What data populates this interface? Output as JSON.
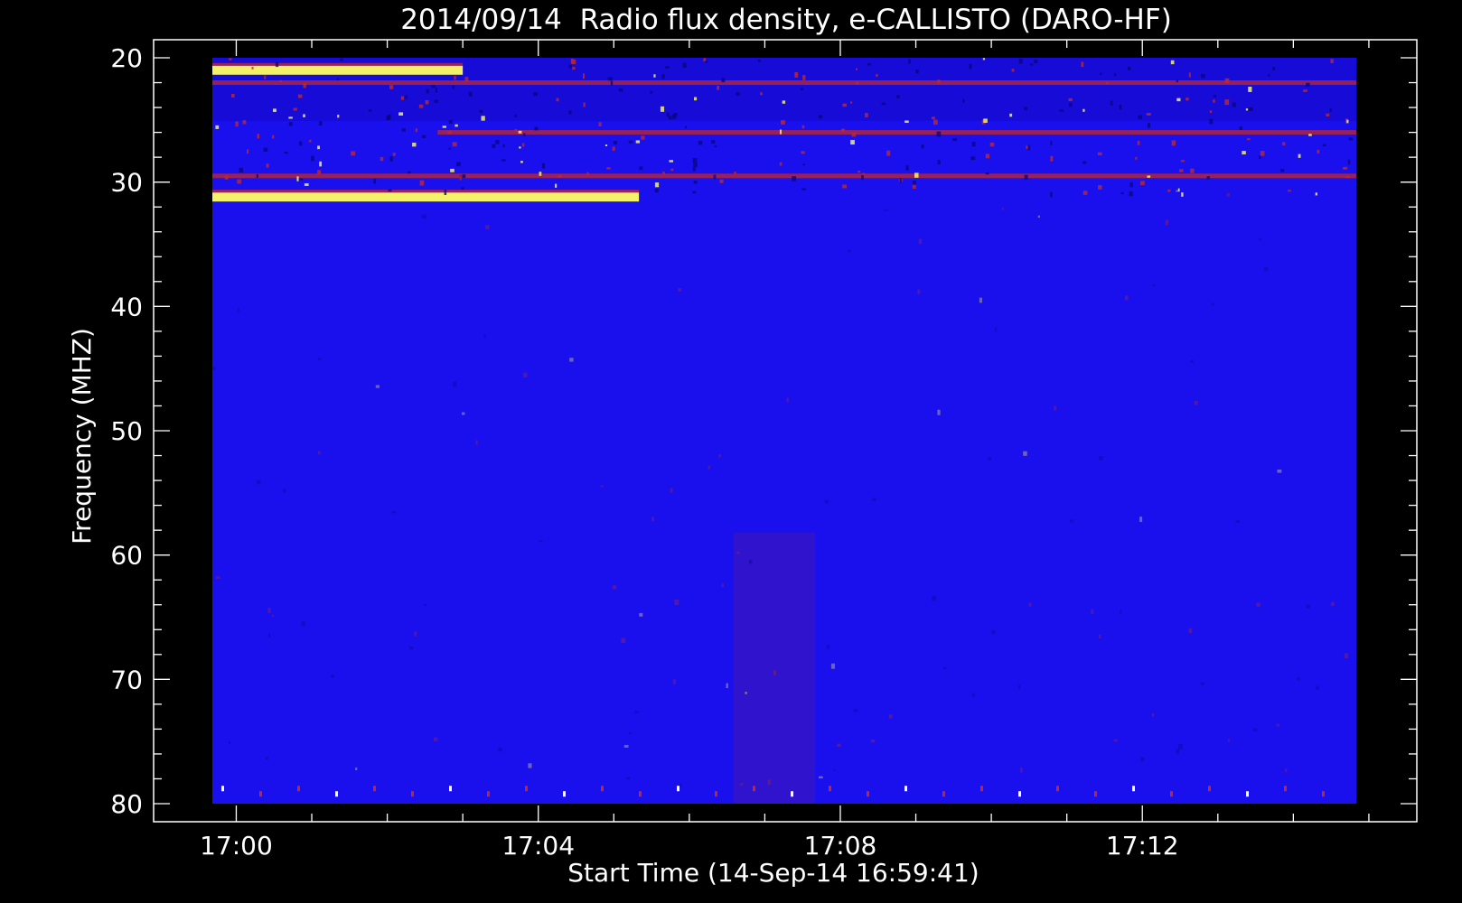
{
  "chart_data": {
    "type": "heatmap",
    "title": "2014/09/14  Radio flux density, e-CALLISTO (DARO-HF)",
    "xlabel": "Start Time (14-Sep-14 16:59:41)",
    "ylabel": "Frequency (MHZ)",
    "x_ticks": [
      "17:00",
      "17:04",
      "17:08",
      "17:12"
    ],
    "y_ticks": [
      "20",
      "30",
      "40",
      "50",
      "60",
      "70",
      "80"
    ],
    "y_range": [
      20,
      80
    ],
    "x_range": [
      "16:59:41",
      "17:14:50"
    ],
    "y_reversed": true,
    "colors": {
      "background": "#000000",
      "axes": "#ffffff",
      "low": "#1a10ee",
      "mid": "#c0282a",
      "high": "#ffff60"
    },
    "features": [
      {
        "kind": "band",
        "freq_mhz": 21,
        "t_start": "16:59:41",
        "t_end": "17:03:00",
        "level": "high"
      },
      {
        "kind": "band",
        "freq_mhz": 22,
        "t_start": "16:59:41",
        "t_end": "17:14:50",
        "level": "mid"
      },
      {
        "kind": "band",
        "freq_mhz": 29.5,
        "t_start": "16:59:41",
        "t_end": "17:14:50",
        "level": "mid"
      },
      {
        "kind": "band",
        "freq_mhz": 31.2,
        "t_start": "16:59:41",
        "t_end": "17:05:20",
        "level": "high"
      },
      {
        "kind": "band",
        "freq_mhz": 26,
        "t_start": "17:02:40",
        "t_end": "17:14:50",
        "level": "mid"
      }
    ]
  }
}
